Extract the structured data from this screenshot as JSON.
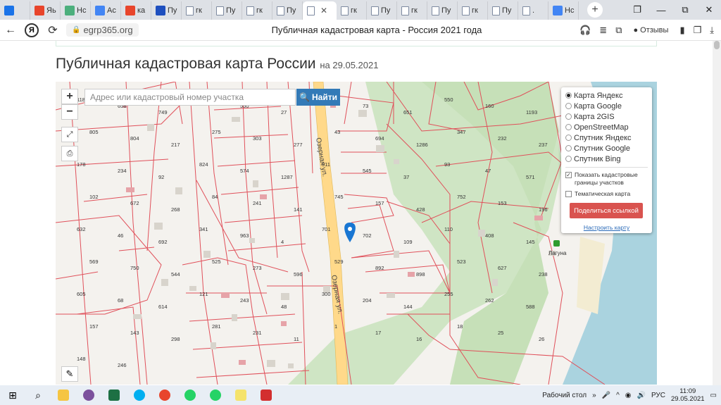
{
  "browser": {
    "tabs": [
      {
        "label": "",
        "icon": "search-icon",
        "color": "#1a73e8"
      },
      {
        "label": "Яь",
        "icon": "yandex-icon",
        "color": "#e8452c"
      },
      {
        "label": "Нс",
        "icon": "site-icon",
        "color": "#4caf7d"
      },
      {
        "label": "Ас",
        "icon": "grid-icon",
        "color": "#4285f4"
      },
      {
        "label": "ка",
        "icon": "yandex-icon",
        "color": "#e8452c"
      },
      {
        "label": "Пу",
        "icon": "flag-icon",
        "color": "#1e4fbf"
      },
      {
        "label": "гк",
        "icon": "doc-icon",
        "color": "#ffffff"
      },
      {
        "label": "Пу",
        "icon": "doc-icon",
        "color": "#ffffff"
      },
      {
        "label": "гк",
        "icon": "doc-icon",
        "color": "#ffffff"
      },
      {
        "label": "Пу",
        "icon": "doc-icon",
        "color": "#ffffff"
      },
      {
        "label": "",
        "icon": "doc-icon",
        "color": "#ffffff",
        "active": true
      },
      {
        "label": "гк",
        "icon": "doc-icon",
        "color": "#ffffff"
      },
      {
        "label": "Пу",
        "icon": "doc-icon",
        "color": "#ffffff"
      },
      {
        "label": "гк",
        "icon": "doc-icon",
        "color": "#ffffff"
      },
      {
        "label": "Пу",
        "icon": "doc-icon",
        "color": "#ffffff"
      },
      {
        "label": "гк",
        "icon": "doc-icon",
        "color": "#ffffff"
      },
      {
        "label": "Пу",
        "icon": "doc-icon",
        "color": "#ffffff"
      },
      {
        "label": ".",
        "icon": "doc-icon",
        "color": "#ffffff"
      },
      {
        "label": "Нс",
        "icon": "grid-icon",
        "color": "#4285f4"
      }
    ],
    "url": "egrp365.org",
    "page_title": "Публичная кадастровая карта - Россия 2021 года",
    "reviews_label": "Отзывы"
  },
  "page": {
    "heading": "Публичная кадастровая карта России",
    "heading_date": "на 29.05.2021"
  },
  "map": {
    "zoom_in": "+",
    "zoom_out": "−",
    "search_placeholder": "Адрес или кадастровый номер участка",
    "search_button": "Найти",
    "layers": [
      {
        "label": "Карта Яндекс",
        "selected": true
      },
      {
        "label": "Карта Google",
        "selected": false
      },
      {
        "label": "Карта 2GIS",
        "selected": false
      },
      {
        "label": "OpenStreetMap",
        "selected": false
      },
      {
        "label": "Спутник Яндекс",
        "selected": false
      },
      {
        "label": "Спутник Google",
        "selected": false
      },
      {
        "label": "Спутник Bing",
        "selected": false
      }
    ],
    "show_borders_label": "Показать кадастровые границы участков",
    "show_borders_checked": true,
    "thematic_label": "Тематическая карта",
    "thematic_checked": false,
    "share_button": "Поделиться ссылкой",
    "settings_link": "Настроить карту",
    "street_label_1": "Озерная ул.",
    "street_label_2": "Озерная ул.",
    "place_label": "Лагуна",
    "parcels": [
      "1187",
      "658",
      "749",
      "69",
      "550",
      "27",
      "201",
      "73",
      "651",
      "550",
      "160",
      "1193",
      "805",
      "804",
      "217",
      "275",
      "303",
      "277",
      "43",
      "694",
      "1286",
      "347",
      "232",
      "237",
      "178",
      "234",
      "92",
      "824",
      "574",
      "1287",
      "911",
      "545",
      "37",
      "93",
      "47",
      "571",
      "102",
      "672",
      "268",
      "84",
      "241",
      "141",
      "745",
      "157",
      "428",
      "752",
      "153",
      "196",
      "632",
      "46",
      "692",
      "341",
      "963",
      "4",
      "701",
      "702",
      "109",
      "110",
      "408",
      "145",
      "569",
      "750",
      "544",
      "525",
      "273",
      "596",
      "529",
      "892",
      "898",
      "523",
      "627",
      "238",
      "605",
      "68",
      "614",
      "121",
      "243",
      "48",
      "300",
      "204",
      "144",
      "255",
      "262",
      "588",
      "157",
      "143",
      "298",
      "281",
      "231",
      "11",
      "1",
      "17",
      "16",
      "18",
      "25",
      "26",
      "148",
      "246"
    ],
    "zoom_in_title": "",
    "fullscreen_icon": "expand-icon",
    "print_icon": "printer-icon",
    "ruler_icon": "ruler-icon"
  },
  "taskbar": {
    "desktop_label": "Рабочий стол",
    "lang": "РУС",
    "time": "11:09",
    "date": "29.05.2021"
  }
}
